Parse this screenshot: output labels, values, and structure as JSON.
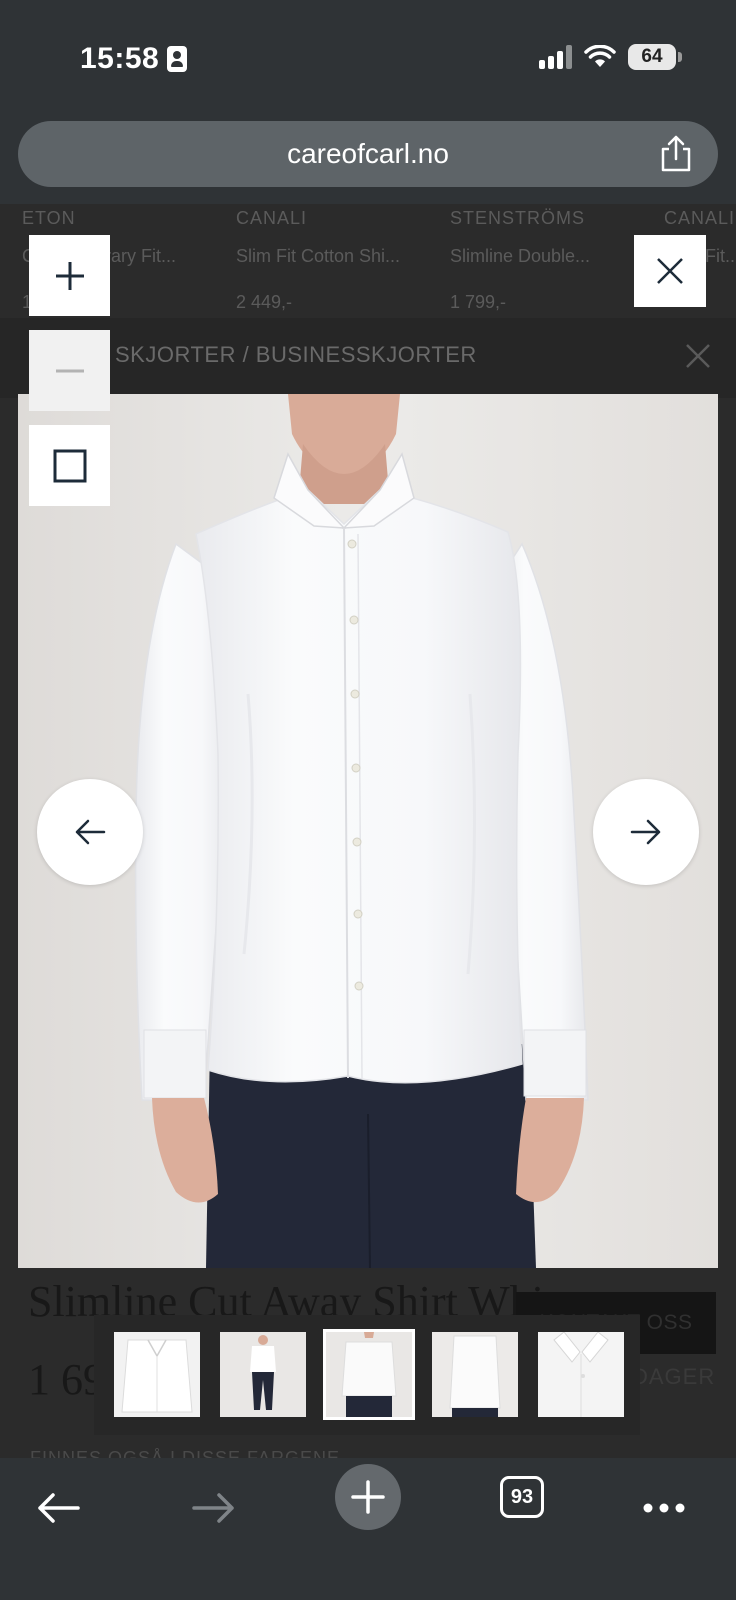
{
  "status_bar": {
    "time": "15:58",
    "battery": "64"
  },
  "browser": {
    "url": "careofcarl.no",
    "tab_count": "93"
  },
  "recommendations": [
    {
      "brand": "ETON",
      "name": "Contemporary Fit...",
      "price": "1..."
    },
    {
      "brand": "CANALI",
      "name": "Slim Fit Cotton Shi...",
      "price": "2 449,-"
    },
    {
      "brand": "STENSTRÖMS",
      "name": "Slimline Double...",
      "price": "1 799,-"
    },
    {
      "brand": "CANALI",
      "name": "...Fit...",
      "price": ""
    }
  ],
  "breadcrumb": "SKJORTER / BUSINESSKJORTER",
  "product": {
    "title": "Slimline Cut Away Shirt Whi",
    "price": "1 69",
    "contact_button": "KONTAKT OSS",
    "delivery_days": "DAGER",
    "colors_heading": "FINNES OGSÅ I DISSE FARGENE"
  },
  "gallery": {
    "active_index": 2,
    "thumbnail_count": 5
  },
  "colors": {
    "page_background": "#2f3336",
    "url_bar": "#5e6468",
    "image_background": "#e7e4e2",
    "shirt": "#ffffff",
    "trousers": "#232838"
  }
}
